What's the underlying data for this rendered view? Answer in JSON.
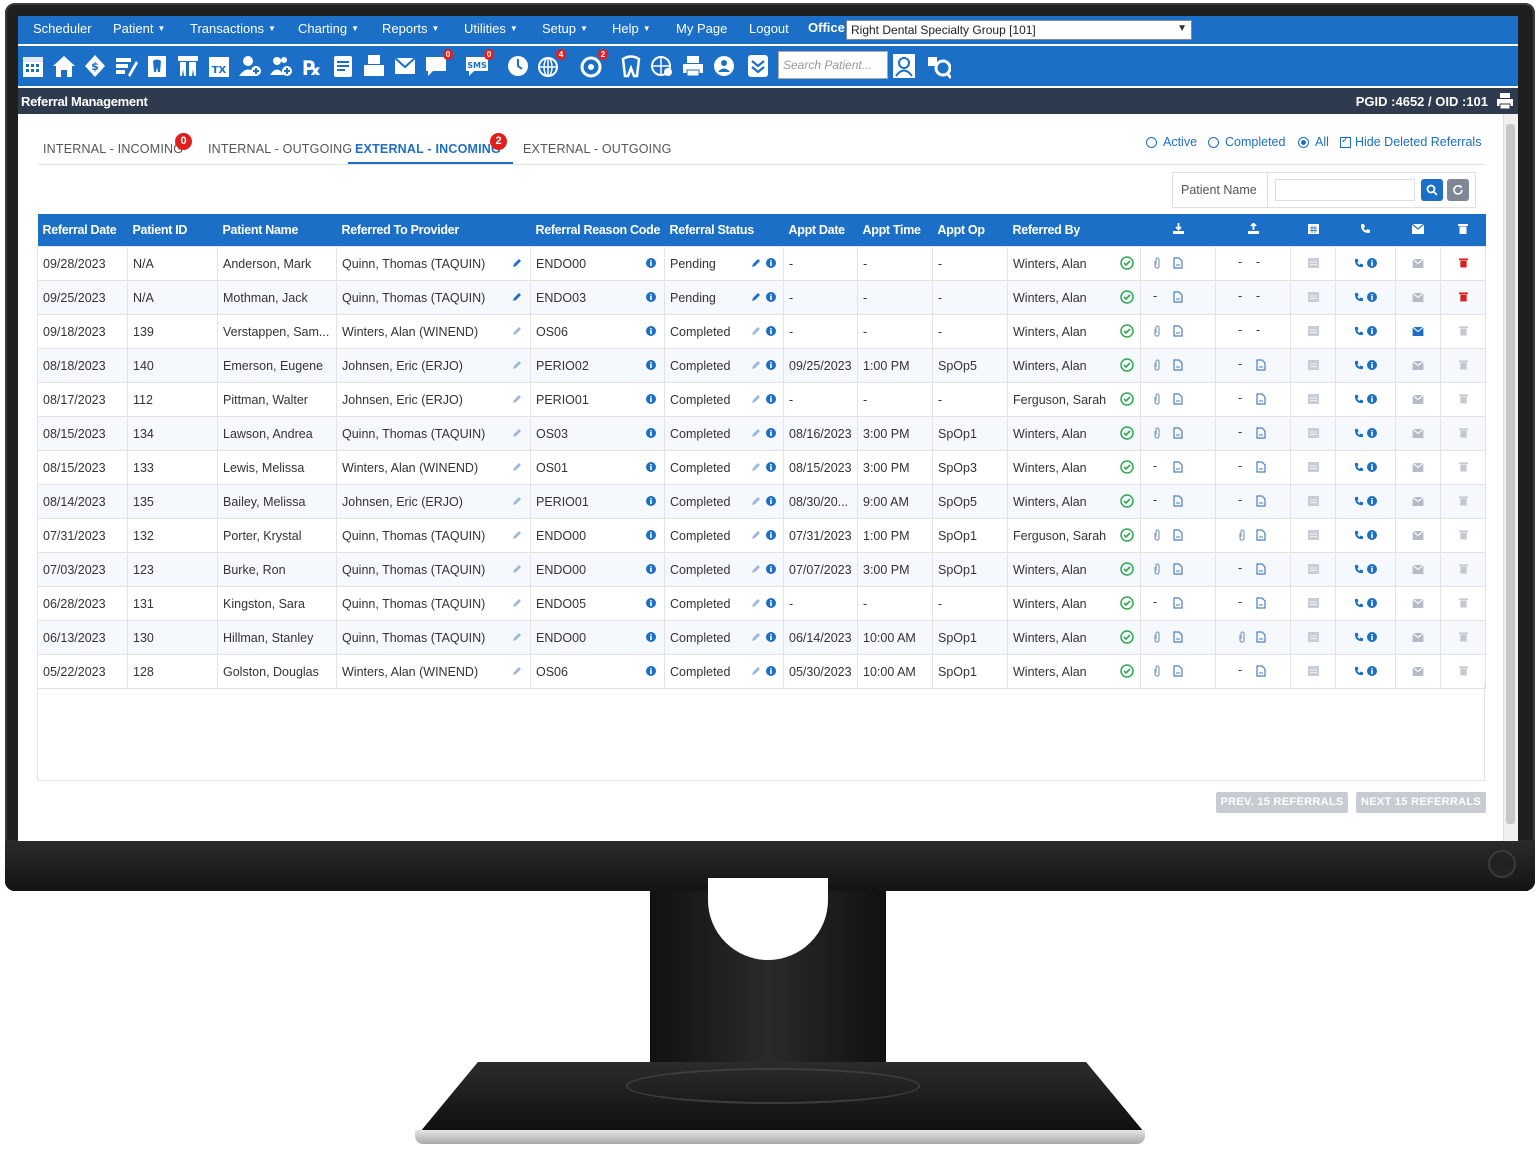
{
  "menu": {
    "items": [
      "Scheduler",
      "Patient",
      "Transactions",
      "Charting",
      "Reports",
      "Utilities",
      "Setup",
      "Help",
      "My Page",
      "Logout"
    ],
    "dropdown_flags": [
      false,
      true,
      true,
      true,
      true,
      true,
      true,
      true,
      false,
      false
    ],
    "office_label": "Office",
    "office_value": "Right Dental Specialty Group [101]"
  },
  "toolbar": {
    "badges": {
      "messages": "0",
      "sms": "0",
      "globe_alert": "4",
      "recall": "2"
    },
    "search_placeholder": "Search Patient..."
  },
  "titlebar": {
    "title": "Referral Management",
    "pgid": "PGID :4652  /  OID :101"
  },
  "tabs": [
    {
      "label": "INTERNAL - INCOMING",
      "badge": "0"
    },
    {
      "label": "INTERNAL - OUTGOING",
      "badge": ""
    },
    {
      "label": "EXTERNAL - INCOMING",
      "badge": "2"
    },
    {
      "label": "EXTERNAL - OUTGOING",
      "badge": ""
    }
  ],
  "filters": {
    "active": "Active",
    "completed": "Completed",
    "all": "All",
    "hide_deleted": "Hide Deleted Referrals",
    "selected": "All",
    "hide_deleted_checked": true
  },
  "search": {
    "label": "Patient Name",
    "value": ""
  },
  "table": {
    "headers": [
      "Referral Date",
      "Patient ID",
      "Patient Name",
      "Referred To Provider",
      "Referral Reason Code",
      "Referral Status",
      "Appt Date",
      "Appt Time",
      "Appt Op",
      "Referred By"
    ],
    "rows": [
      {
        "date": "09/28/2023",
        "pid": "N/A",
        "name": "Anderson, Mark",
        "provider": "Quinn, Thomas (TAQUIN)",
        "code": "ENDO00",
        "status": "Pending",
        "appt_date": "-",
        "appt_time": "-",
        "op": "-",
        "by": "Winters, Alan",
        "in": "attach",
        "out": "dash",
        "email_on": false,
        "deletable": true
      },
      {
        "date": "09/25/2023",
        "pid": "N/A",
        "name": "Mothman, Jack",
        "provider": "Quinn, Thomas (TAQUIN)",
        "code": "ENDO03",
        "status": "Pending",
        "appt_date": "-",
        "appt_time": "-",
        "op": "-",
        "by": "Winters, Alan",
        "in": "dash",
        "out": "dash",
        "email_on": false,
        "deletable": true
      },
      {
        "date": "09/18/2023",
        "pid": "139",
        "name": "Verstappen, Sam...",
        "provider": "Winters, Alan (WINEND)",
        "code": "OS06",
        "status": "Completed",
        "appt_date": "-",
        "appt_time": "-",
        "op": "-",
        "by": "Winters, Alan",
        "in": "attach",
        "out": "dash",
        "email_on": true,
        "deletable": false
      },
      {
        "date": "08/18/2023",
        "pid": "140",
        "name": "Emerson, Eugene",
        "provider": "Johnsen, Eric (ERJO)",
        "code": "PERIO02",
        "status": "Completed",
        "appt_date": "09/25/2023",
        "appt_time": "1:00 PM",
        "op": "SpOp5",
        "by": "Winters, Alan",
        "in": "attach",
        "out": "pdf",
        "email_on": false,
        "deletable": false
      },
      {
        "date": "08/17/2023",
        "pid": "112",
        "name": "Pittman, Walter",
        "provider": "Johnsen, Eric (ERJO)",
        "code": "PERIO01",
        "status": "Completed",
        "appt_date": "-",
        "appt_time": "-",
        "op": "-",
        "by": "Ferguson, Sarah",
        "in": "attach",
        "out": "pdf",
        "email_on": false,
        "deletable": false
      },
      {
        "date": "08/15/2023",
        "pid": "134",
        "name": "Lawson, Andrea",
        "provider": "Quinn, Thomas (TAQUIN)",
        "code": "OS03",
        "status": "Completed",
        "appt_date": "08/16/2023",
        "appt_time": "3:00 PM",
        "op": "SpOp1",
        "by": "Winters, Alan",
        "in": "attach",
        "out": "pdf",
        "email_on": false,
        "deletable": false
      },
      {
        "date": "08/15/2023",
        "pid": "133",
        "name": "Lewis, Melissa",
        "provider": "Winters, Alan (WINEND)",
        "code": "OS01",
        "status": "Completed",
        "appt_date": "08/15/2023",
        "appt_time": "3:00 PM",
        "op": "SpOp3",
        "by": "Winters, Alan",
        "in": "dash",
        "out": "pdf",
        "email_on": false,
        "deletable": false
      },
      {
        "date": "08/14/2023",
        "pid": "135",
        "name": "Bailey, Melissa",
        "provider": "Johnsen, Eric (ERJO)",
        "code": "PERIO01",
        "status": "Completed",
        "appt_date": "08/30/20...",
        "appt_time": "9:00 AM",
        "op": "SpOp5",
        "by": "Winters, Alan",
        "in": "dash",
        "out": "pdf",
        "email_on": false,
        "deletable": false
      },
      {
        "date": "07/31/2023",
        "pid": "132",
        "name": "Porter, Krystal",
        "provider": "Quinn, Thomas (TAQUIN)",
        "code": "ENDO00",
        "status": "Completed",
        "appt_date": "07/31/2023",
        "appt_time": "1:00 PM",
        "op": "SpOp1",
        "by": "Ferguson, Sarah",
        "in": "attach",
        "out": "attachpdf",
        "email_on": false,
        "deletable": false
      },
      {
        "date": "07/03/2023",
        "pid": "123",
        "name": "Burke, Ron",
        "provider": "Quinn, Thomas (TAQUIN)",
        "code": "ENDO00",
        "status": "Completed",
        "appt_date": "07/07/2023",
        "appt_time": "3:00 PM",
        "op": "SpOp1",
        "by": "Winters, Alan",
        "in": "attach",
        "out": "pdf",
        "email_on": false,
        "deletable": false
      },
      {
        "date": "06/28/2023",
        "pid": "131",
        "name": "Kingston, Sara",
        "provider": "Quinn, Thomas (TAQUIN)",
        "code": "ENDO05",
        "status": "Completed",
        "appt_date": "-",
        "appt_time": "-",
        "op": "-",
        "by": "Winters, Alan",
        "in": "dash",
        "out": "pdf",
        "email_on": false,
        "deletable": false
      },
      {
        "date": "06/13/2023",
        "pid": "130",
        "name": "Hillman, Stanley",
        "provider": "Quinn, Thomas (TAQUIN)",
        "code": "ENDO00",
        "status": "Completed",
        "appt_date": "06/14/2023",
        "appt_time": "10:00 AM",
        "op": "SpOp1",
        "by": "Winters, Alan",
        "in": "attach",
        "out": "attachpdf",
        "email_on": false,
        "deletable": false
      },
      {
        "date": "05/22/2023",
        "pid": "128",
        "name": "Golston, Douglas",
        "provider": "Winters, Alan (WINEND)",
        "code": "OS06",
        "status": "Completed",
        "appt_date": "05/30/2023",
        "appt_time": "10:00 AM",
        "op": "SpOp1",
        "by": "Winters, Alan",
        "in": "attach",
        "out": "pdf",
        "email_on": false,
        "deletable": false
      }
    ]
  },
  "pager": {
    "prev": "PREV. 15 REFERRALS",
    "next": "NEXT 15 REFERRALS"
  },
  "colors": {
    "primary": "#1b6fc6",
    "titlebar": "#2e3b4e",
    "badge": "#e01e1e",
    "ok": "#2fa84f",
    "delete": "#d92020"
  }
}
